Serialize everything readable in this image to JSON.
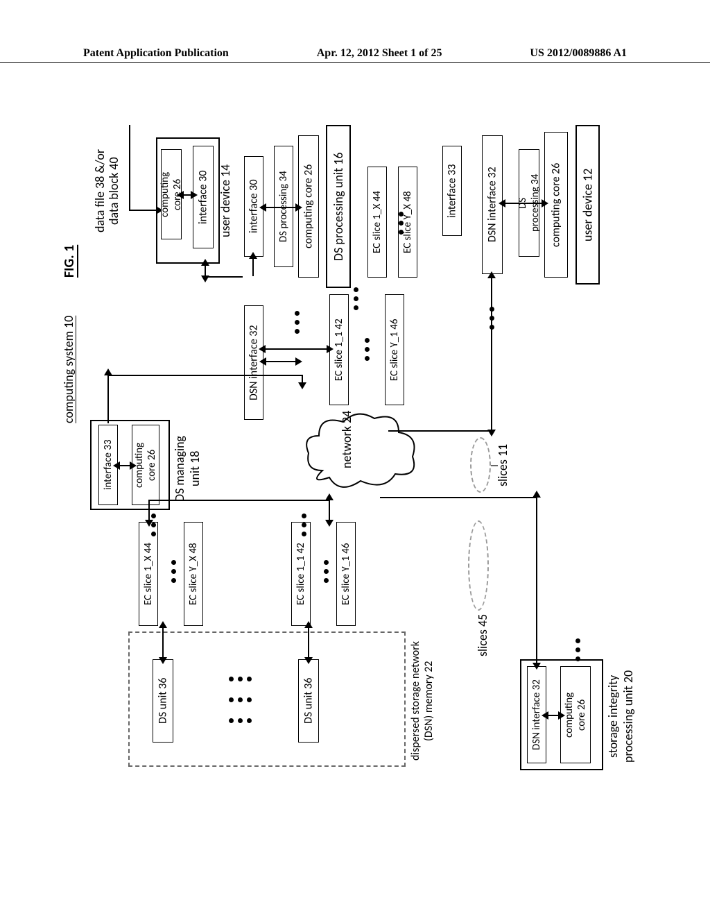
{
  "header": {
    "left": "Patent Application Publication",
    "center": "Apr. 12, 2012  Sheet 1 of 25",
    "right": "US 2012/0089886 A1"
  },
  "figure": {
    "label": "FIG. 1",
    "system": "computing system 10"
  },
  "blocks": {
    "user_device_12": "user device 12",
    "computing_core_26_a": "computing core 26",
    "ds_processing_34_a": "DS\nprocessing 34",
    "dsn_interface_32_a": "DSN interface 32",
    "slices_11": "slices 11",
    "slices_45": "slices 45",
    "ds_processing_unit_16": "DS processing unit 16",
    "computing_core_26_b": "computing core 26",
    "ds_processing_34_b": "DS processing 34",
    "interface_30_a": "interface 30",
    "dsn_interface_32_b": "DSN interface 32",
    "data_file_38": "data file 38 &/or",
    "data_block_40": "data block 40",
    "user_device_14": "user device 14",
    "computing_core_26_c": "computing\ncore 26",
    "interface_30_b": "interface 30",
    "ec_slice_1_1_42_a": "EC slice 1_1 42",
    "ec_slice_1_x_44_a": "EC slice 1_X 44",
    "ec_slice_y_1_46_a": "EC slice Y_1 46",
    "ec_slice_y_x_48_a": "EC slice Y_X 48",
    "interface_33": "interface 33",
    "computing_core_26_d": "computing\ncore 26",
    "ds_managing_unit_18": "DS managing\nunit 18",
    "network_24": "network 24",
    "storage_integrity_20": "storage integrity\nprocessing unit 20",
    "dsn_interface_32_c": "DSN interface 32",
    "computing_core_26_e": "computing\ncore 26",
    "ec_slice_1_1_42_b": "EC slice 1_1 42",
    "ec_slice_y_1_46_b": "EC slice Y_1 46",
    "ec_slice_1_x_44_b": "EC slice 1_X 44",
    "ec_slice_y_x_48_b": "EC slice Y_X 48",
    "ds_unit_36_a": "DS unit 36",
    "ds_unit_36_b": "DS unit 36",
    "dsn_memory_22": "dispersed storage network (DSN) memory 22"
  },
  "chart_data": {
    "type": "diagram",
    "title": "FIG. 1 - computing system 10",
    "nodes": [
      {
        "id": "user_device_12",
        "label": "user device 12",
        "contains": [
          "computing_core_26_a",
          "ds_processing_34_a",
          "dsn_interface_32_a"
        ]
      },
      {
        "id": "computing_core_26_a",
        "label": "computing core 26"
      },
      {
        "id": "ds_processing_34_a",
        "label": "DS processing 34"
      },
      {
        "id": "dsn_interface_32_a",
        "label": "DSN interface 32"
      },
      {
        "id": "ds_processing_unit_16",
        "label": "DS processing unit 16",
        "contains": [
          "computing_core_26_b",
          "ds_processing_34_b",
          "interface_30_a",
          "dsn_interface_32_b"
        ]
      },
      {
        "id": "computing_core_26_b",
        "label": "computing core 26"
      },
      {
        "id": "ds_processing_34_b",
        "label": "DS processing 34"
      },
      {
        "id": "interface_30_a",
        "label": "interface 30"
      },
      {
        "id": "dsn_interface_32_b",
        "label": "DSN interface 32"
      },
      {
        "id": "user_device_14",
        "label": "user device 14",
        "contains": [
          "computing_core_26_c",
          "interface_30_b"
        ]
      },
      {
        "id": "computing_core_26_c",
        "label": "computing core 26"
      },
      {
        "id": "interface_30_b",
        "label": "interface 30"
      },
      {
        "id": "data_file_38_40",
        "label": "data file 38 &/or data block 40"
      },
      {
        "id": "ec_slice_1_1_42_a",
        "label": "EC slice 1_1 42"
      },
      {
        "id": "ec_slice_1_x_44_a",
        "label": "EC slice 1_X 44"
      },
      {
        "id": "ec_slice_y_1_46_a",
        "label": "EC slice Y_1 46"
      },
      {
        "id": "ec_slice_y_x_48_a",
        "label": "EC slice Y_X 48"
      },
      {
        "id": "ds_managing_unit_18",
        "label": "DS managing unit 18",
        "contains": [
          "interface_33",
          "computing_core_26_d"
        ]
      },
      {
        "id": "interface_33",
        "label": "interface 33"
      },
      {
        "id": "computing_core_26_d",
        "label": "computing core 26"
      },
      {
        "id": "network_24",
        "label": "network 24",
        "shape": "cloud"
      },
      {
        "id": "storage_integrity_20",
        "label": "storage integrity processing unit 20",
        "contains": [
          "dsn_interface_32_c",
          "computing_core_26_e"
        ]
      },
      {
        "id": "dsn_interface_32_c",
        "label": "DSN interface 32"
      },
      {
        "id": "computing_core_26_e",
        "label": "computing core 26"
      },
      {
        "id": "dsn_memory_22",
        "label": "dispersed storage network (DSN) memory 22",
        "contains": [
          "ds_unit_36_a",
          "ds_unit_36_b"
        ]
      },
      {
        "id": "ds_unit_36_a",
        "label": "DS unit 36"
      },
      {
        "id": "ds_unit_36_b",
        "label": "DS unit 36"
      },
      {
        "id": "ec_slice_1_1_42_b",
        "label": "EC slice 1_1 42"
      },
      {
        "id": "ec_slice_y_1_46_b",
        "label": "EC slice Y_1 46"
      },
      {
        "id": "ec_slice_1_x_44_b",
        "label": "EC slice 1_X 44"
      },
      {
        "id": "ec_slice_y_x_48_b",
        "label": "EC slice Y_X 48"
      },
      {
        "id": "slices_11",
        "label": "slices 11"
      },
      {
        "id": "slices_45",
        "label": "slices 45"
      }
    ],
    "edges": [
      {
        "from": "dsn_interface_32_a",
        "to": "network_24",
        "label": "slices 11",
        "bidirectional": true
      },
      {
        "from": "dsn_interface_32_b",
        "to": "network_24",
        "bidirectional": true
      },
      {
        "from": "interface_30_a",
        "to": "interface_30_b",
        "bidirectional": true
      },
      {
        "from": "data_file_38_40",
        "to": "user_device_14",
        "bidirectional": false
      },
      {
        "from": "ds_processing_unit_16",
        "to": "ec_slice_1_1_42_a",
        "bidirectional": true
      },
      {
        "from": "ds_processing_unit_16",
        "to": "ec_slice_1_x_44_a",
        "bidirectional": true
      },
      {
        "from": "ec_slice_y_1_46_a",
        "to": "network_24",
        "bidirectional": true
      },
      {
        "from": "ec_slice_y_x_48_a",
        "to": "network_24",
        "bidirectional": true
      },
      {
        "from": "interface_33",
        "to": "network_24",
        "bidirectional": true
      },
      {
        "from": "dsn_interface_32_c",
        "to": "network_24",
        "label": "slices 45",
        "bidirectional": true
      },
      {
        "from": "network_24",
        "to": "ec_slice_1_1_42_b",
        "bidirectional": true
      },
      {
        "from": "network_24",
        "to": "ec_slice_1_x_44_b",
        "bidirectional": true
      },
      {
        "from": "ec_slice_1_1_42_b",
        "to": "ds_unit_36_a",
        "bidirectional": true
      },
      {
        "from": "ec_slice_y_1_46_b",
        "to": "ds_unit_36_a",
        "bidirectional": true
      },
      {
        "from": "ec_slice_1_x_44_b",
        "to": "ds_unit_36_b",
        "bidirectional": true
      },
      {
        "from": "ec_slice_y_x_48_b",
        "to": "ds_unit_36_b",
        "bidirectional": true
      },
      {
        "from": "computing_core_26_a",
        "to": "dsn_interface_32_a",
        "bidirectional": true
      },
      {
        "from": "computing_core_26_b",
        "to": "interface_30_a",
        "bidirectional": true
      },
      {
        "from": "computing_core_26_b",
        "to": "dsn_interface_32_b",
        "bidirectional": true
      },
      {
        "from": "computing_core_26_c",
        "to": "interface_30_b",
        "bidirectional": true
      },
      {
        "from": "computing_core_26_d",
        "to": "interface_33",
        "bidirectional": true
      },
      {
        "from": "computing_core_26_e",
        "to": "dsn_interface_32_c",
        "bidirectional": true
      }
    ]
  }
}
